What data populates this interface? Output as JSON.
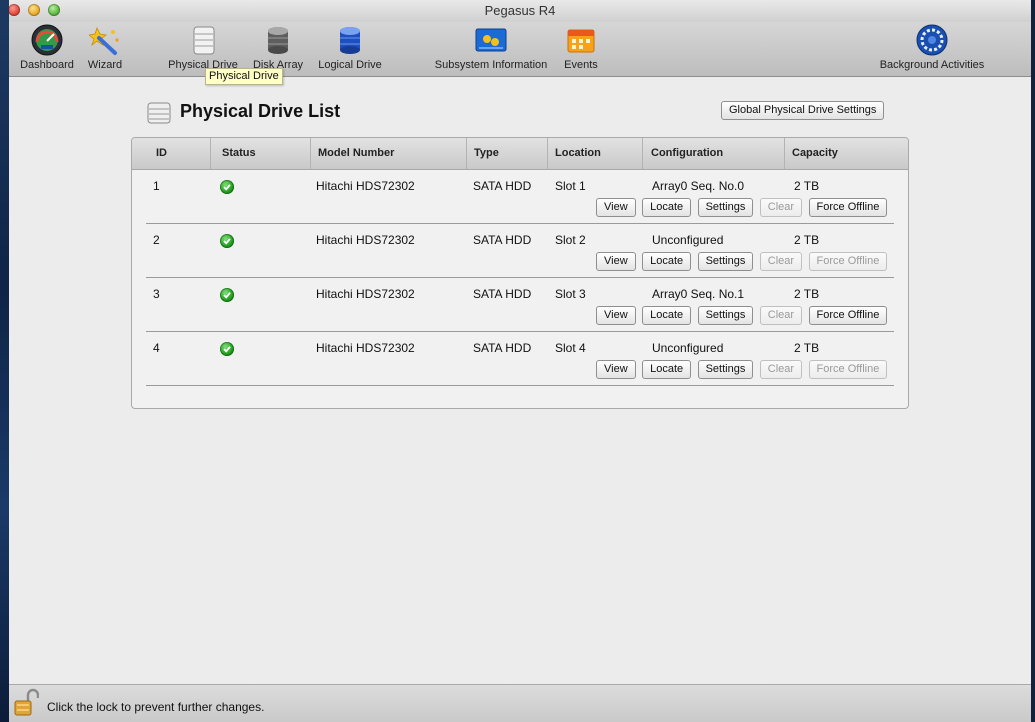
{
  "window": {
    "title": "Pegasus R4"
  },
  "toolbar": {
    "items": [
      {
        "label": "Dashboard",
        "icon": "dashboard-gauge-icon"
      },
      {
        "label": "Wizard",
        "icon": "wizard-wand-icon"
      },
      {
        "label": "Physical Drive",
        "icon": "physical-drive-icon"
      },
      {
        "label": "Disk Array",
        "icon": "disk-array-icon"
      },
      {
        "label": "Logical Drive",
        "icon": "logical-drive-icon"
      },
      {
        "label": "Subsystem Information",
        "icon": "subsystem-info-icon"
      },
      {
        "label": "Events",
        "icon": "events-calendar-icon"
      },
      {
        "label": "Background Activities",
        "icon": "background-activities-icon"
      }
    ],
    "tooltip": "Physical Drive"
  },
  "page": {
    "title": "Physical Drive List",
    "global_settings_button": "Global Physical Drive Settings"
  },
  "table": {
    "columns": [
      "ID",
      "Status",
      "Model Number",
      "Type",
      "Location",
      "Configuration",
      "Capacity"
    ],
    "actions": [
      "View",
      "Locate",
      "Settings",
      "Clear",
      "Force Offline"
    ],
    "rows": [
      {
        "id": "1",
        "status": "ok",
        "model": "Hitachi HDS72302",
        "type": "SATA HDD",
        "location": "Slot 1",
        "configuration": "Array0 Seq. No.0",
        "capacity": "2 TB",
        "force_offline_enabled": true
      },
      {
        "id": "2",
        "status": "ok",
        "model": "Hitachi HDS72302",
        "type": "SATA HDD",
        "location": "Slot 2",
        "configuration": "Unconfigured",
        "capacity": "2 TB",
        "force_offline_enabled": false
      },
      {
        "id": "3",
        "status": "ok",
        "model": "Hitachi HDS72302",
        "type": "SATA HDD",
        "location": "Slot 3",
        "configuration": "Array0 Seq. No.1",
        "capacity": "2 TB",
        "force_offline_enabled": true
      },
      {
        "id": "4",
        "status": "ok",
        "model": "Hitachi HDS72302",
        "type": "SATA HDD",
        "location": "Slot 4",
        "configuration": "Unconfigured",
        "capacity": "2 TB",
        "force_offline_enabled": false
      }
    ]
  },
  "footer": {
    "lock_text": "Click the lock to prevent further changes."
  },
  "colors": {
    "status_ok": "#1e9a1a",
    "tooltip_bg": "#ffffc6"
  }
}
